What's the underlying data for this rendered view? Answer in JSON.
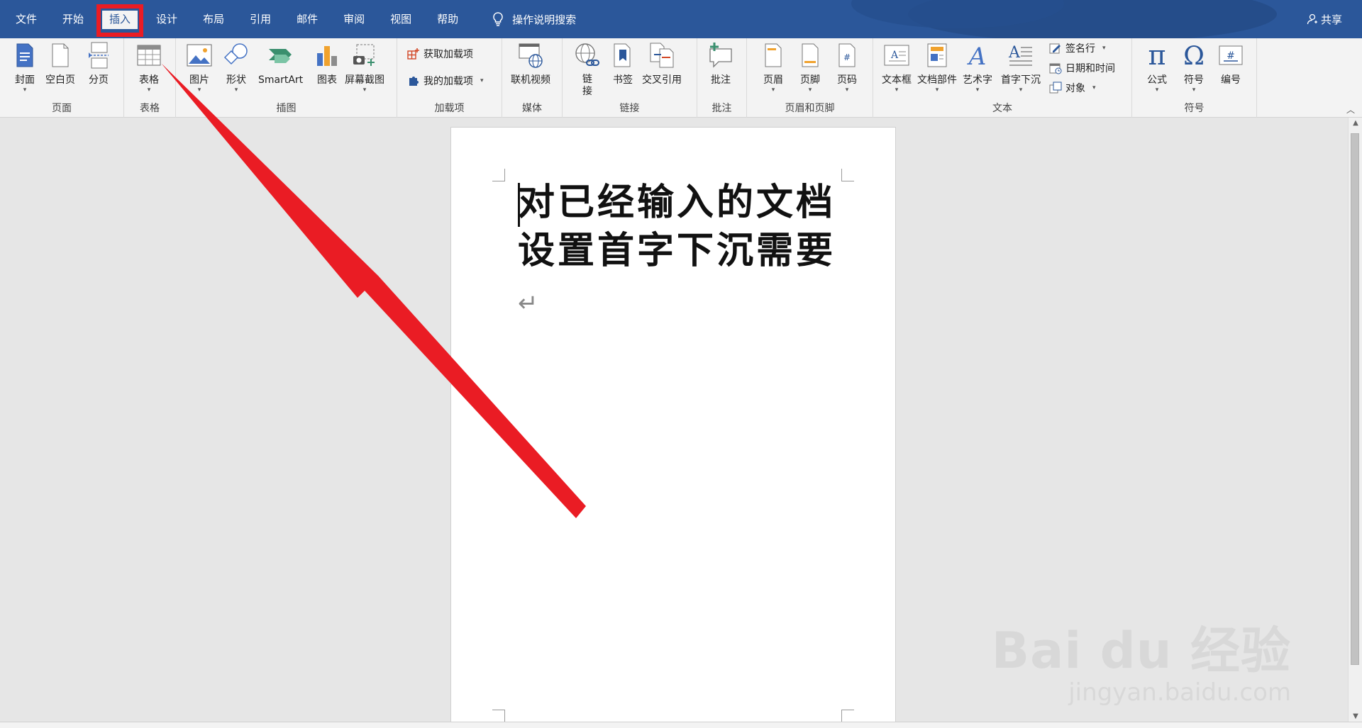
{
  "tabs": [
    {
      "label": "文件"
    },
    {
      "label": "开始"
    },
    {
      "label": "插入",
      "active": true
    },
    {
      "label": "设计"
    },
    {
      "label": "布局"
    },
    {
      "label": "引用"
    },
    {
      "label": "邮件"
    },
    {
      "label": "审阅"
    },
    {
      "label": "视图"
    },
    {
      "label": "帮助"
    }
  ],
  "tell_me": "操作说明搜索",
  "share": "共享",
  "ribbon": {
    "pages": {
      "label": "页面",
      "cover": "封面",
      "blank": "空白页",
      "break": "分页"
    },
    "tables": {
      "label": "表格",
      "table": "表格"
    },
    "illustrations": {
      "label": "插图",
      "pictures": "图片",
      "shapes": "形状",
      "smartart": "SmartArt",
      "chart": "图表",
      "screenshot": "屏幕截图"
    },
    "addins": {
      "label": "加载项",
      "get": "获取加载项",
      "mine": "我的加载项"
    },
    "media": {
      "label": "媒体",
      "video": "联机视频"
    },
    "links": {
      "label": "链接",
      "link_1": "链",
      "link_2": "接",
      "bookmark": "书签",
      "crossref": "交叉引用"
    },
    "comments": {
      "label": "批注",
      "comment": "批注"
    },
    "headerfooter": {
      "label": "页眉和页脚",
      "header": "页眉",
      "footer": "页脚",
      "pagenum": "页码"
    },
    "text": {
      "label": "文本",
      "textbox": "文本框",
      "quickparts": "文档部件",
      "wordart": "艺术字",
      "dropcap": "首字下沉",
      "signature": "签名行",
      "datetime": "日期和时间",
      "object": "对象"
    },
    "symbols": {
      "label": "符号",
      "equation": "公式",
      "symbol": "符号",
      "number": "编号"
    }
  },
  "document": {
    "line1": "对已经输入的文档",
    "line2": "设置首字下沉需要",
    "pilcrow": "↵"
  },
  "watermark": {
    "big": "Bai du 经验",
    "small": "jingyan.baidu.com"
  },
  "colors": {
    "ribbon_blue": "#2b579a",
    "annotation_red": "#ea1c24"
  }
}
